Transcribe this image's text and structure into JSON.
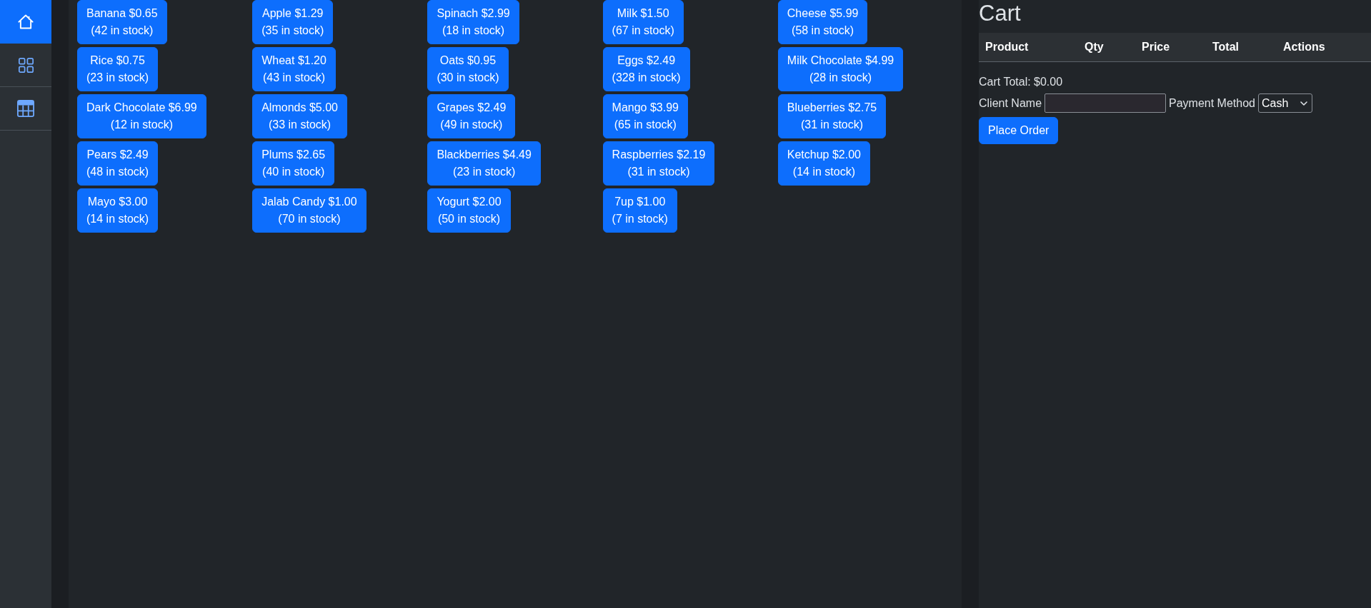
{
  "sidebar": {
    "items": [
      {
        "selected": true
      },
      {
        "selected": false
      },
      {
        "selected": false
      }
    ]
  },
  "products": [
    {
      "label": "Banana $0.65",
      "stock": "(42 in stock)"
    },
    {
      "label": "Apple $1.29",
      "stock": "(35 in stock)"
    },
    {
      "label": "Spinach $2.99",
      "stock": "(18 in stock)"
    },
    {
      "label": "Milk $1.50",
      "stock": "(67 in stock)"
    },
    {
      "label": "Cheese $5.99",
      "stock": "(58 in stock)"
    },
    {
      "label": "Rice $0.75",
      "stock": "(23 in stock)"
    },
    {
      "label": "Wheat $1.20",
      "stock": "(43 in stock)"
    },
    {
      "label": "Oats $0.95",
      "stock": "(30 in stock)"
    },
    {
      "label": "Eggs $2.49",
      "stock": "(328 in stock)"
    },
    {
      "label": "Milk Chocolate $4.99",
      "stock": "(28 in stock)"
    },
    {
      "label": "Dark Chocolate $6.99",
      "stock": "(12 in stock)"
    },
    {
      "label": "Almonds $5.00",
      "stock": "(33 in stock)"
    },
    {
      "label": "Grapes $2.49",
      "stock": "(49 in stock)"
    },
    {
      "label": "Mango $3.99",
      "stock": "(65 in stock)"
    },
    {
      "label": "Blueberries $2.75",
      "stock": "(31 in stock)"
    },
    {
      "label": "Pears $2.49",
      "stock": "(48 in stock)"
    },
    {
      "label": "Plums $2.65",
      "stock": "(40 in stock)"
    },
    {
      "label": "Blackberries $4.49",
      "stock": "(23 in stock)"
    },
    {
      "label": "Raspberries $2.19",
      "stock": "(31 in stock)"
    },
    {
      "label": "Ketchup $2.00",
      "stock": "(14 in stock)"
    },
    {
      "label": "Mayo $3.00",
      "stock": "(14 in stock)"
    },
    {
      "label": "Jalab Candy $1.00",
      "stock": "(70 in stock)"
    },
    {
      "label": "Yogurt $2.00",
      "stock": "(50 in stock)"
    },
    {
      "label": "7up $1.00",
      "stock": "(7 in stock)"
    }
  ],
  "cart": {
    "title": "Cart",
    "table": {
      "columns": [
        "Product",
        "Qty",
        "Price",
        "Total",
        "Actions"
      ]
    },
    "total": "Cart Total: $0.00",
    "client_name": {
      "label": "Client Name"
    },
    "payment_method": {
      "label": "Payment Method",
      "value": "Cash"
    },
    "place_order": "Place Order"
  }
}
